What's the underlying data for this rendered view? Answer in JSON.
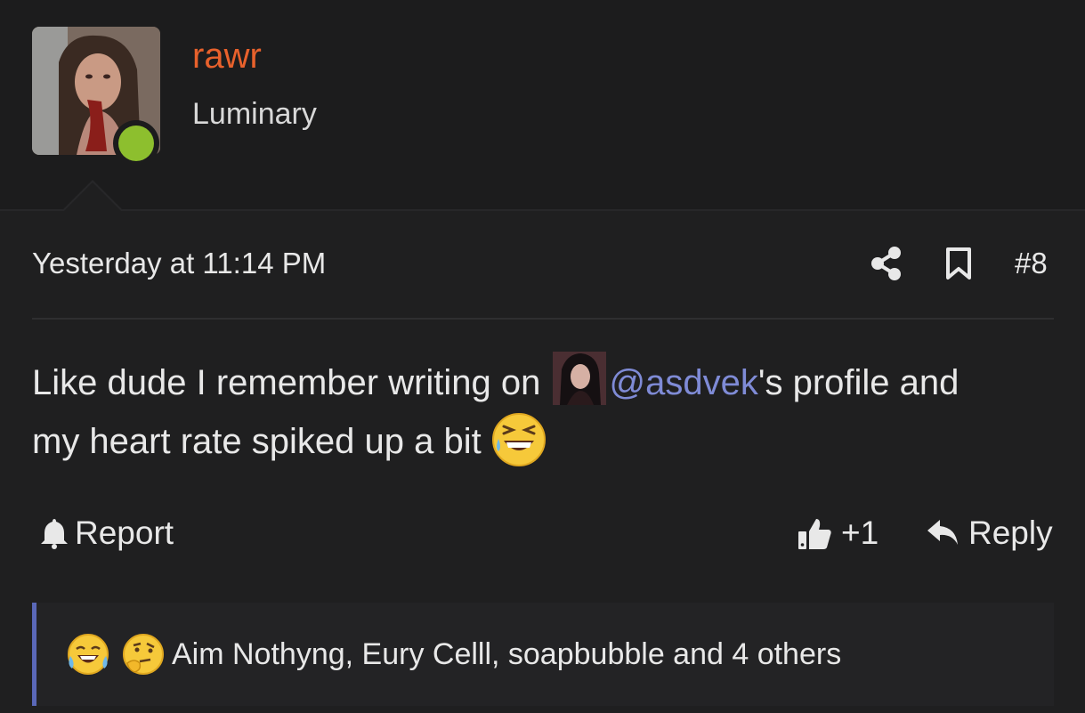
{
  "user": {
    "name": "rawr",
    "title": "Luminary",
    "online": true,
    "name_color": "#e8612c",
    "online_color": "#8dbf2e"
  },
  "post": {
    "timestamp": "Yesterday at 11:14 PM",
    "number": "#8",
    "body_line1_before": "Like dude I remember writing on ",
    "mention": "@asdvek",
    "body_line1_after": "'s profile and",
    "body_line2": "my heart rate spiked up a bit ",
    "mention_color": "#7f8bd6"
  },
  "actions": {
    "report_label": "Report",
    "like_label": "+1",
    "reply_label": "Reply"
  },
  "reactions": {
    "icons": [
      "laughing-crying-emoji",
      "thinking-emoji"
    ],
    "summary": "Aim Nothyng, Eury Celll, soapbubble and 4 others",
    "accent_color": "#5a68b8"
  }
}
